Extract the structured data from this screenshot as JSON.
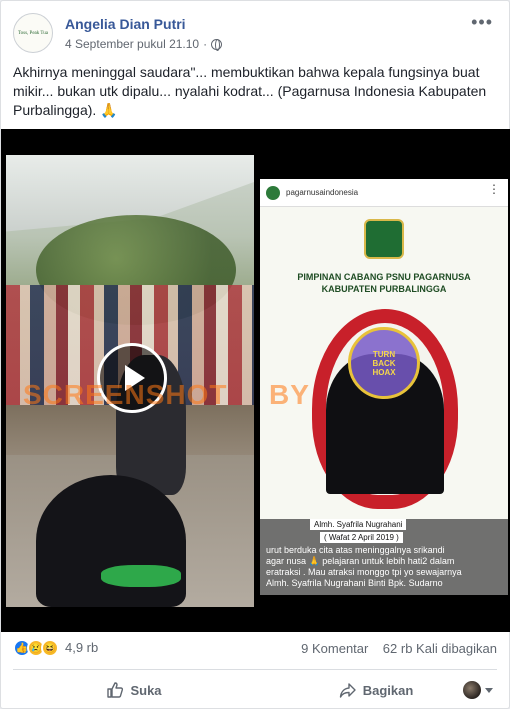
{
  "post": {
    "author": "Angelia Dian Putri",
    "avatar_text": "Toss, Peak Tua",
    "timestamp": "4 September pukul 21.10",
    "text": "Akhirnya meninggal saudara\"... membuktikan bahwa kepala fungsinya buat mikir... bukan utk dipalu... nyalahi kodrat... (Pagarnusa Indonesia Kabupaten Purbalingga). 🙏"
  },
  "media": {
    "watermark_left": "SCREENSHOT",
    "watermark_right": "BY",
    "right_panel": {
      "ig_handle": "pagarnusaindonesia",
      "flyer_title_line1": "PIMPINAN CABANG PSNU PAGARNUSA",
      "flyer_title_line2": "KABUPATEN PURBALINGGA",
      "seal_line1": "TURN",
      "seal_line2": "BACK",
      "seal_line3": "HOAX",
      "caption_name": "Almh. Syafrila Nugrahani",
      "caption_date": "( Wafat 2 April 2019 )",
      "caption_line1": "urut berduka cita atas meninggalnya srikandi",
      "caption_line2": "agar nusa 🙏 pelajaran untuk lebih hati2 dalam",
      "caption_line3": "eratraksi . Mau atraksi monggo tpi yo sewajarnya",
      "caption_line4": "Almh. Syafrila Nugrahani Binti Bpk. Sudarno"
    }
  },
  "stats": {
    "reactions_count": "4,9 rb",
    "comments": "9 Komentar",
    "shares": "62 rb Kali dibagikan"
  },
  "actions": {
    "like_label": "Suka",
    "share_label": "Bagikan"
  },
  "icons": {
    "more": "more-options-icon",
    "privacy": "globe-icon",
    "like": "thumbs-up-icon",
    "share": "share-arrow-icon",
    "play": "play-icon"
  },
  "colors": {
    "author_link": "#385898",
    "like_reaction": "#1877f2",
    "sash_green": "#2ea84a",
    "wreath_red": "#c8202a"
  }
}
